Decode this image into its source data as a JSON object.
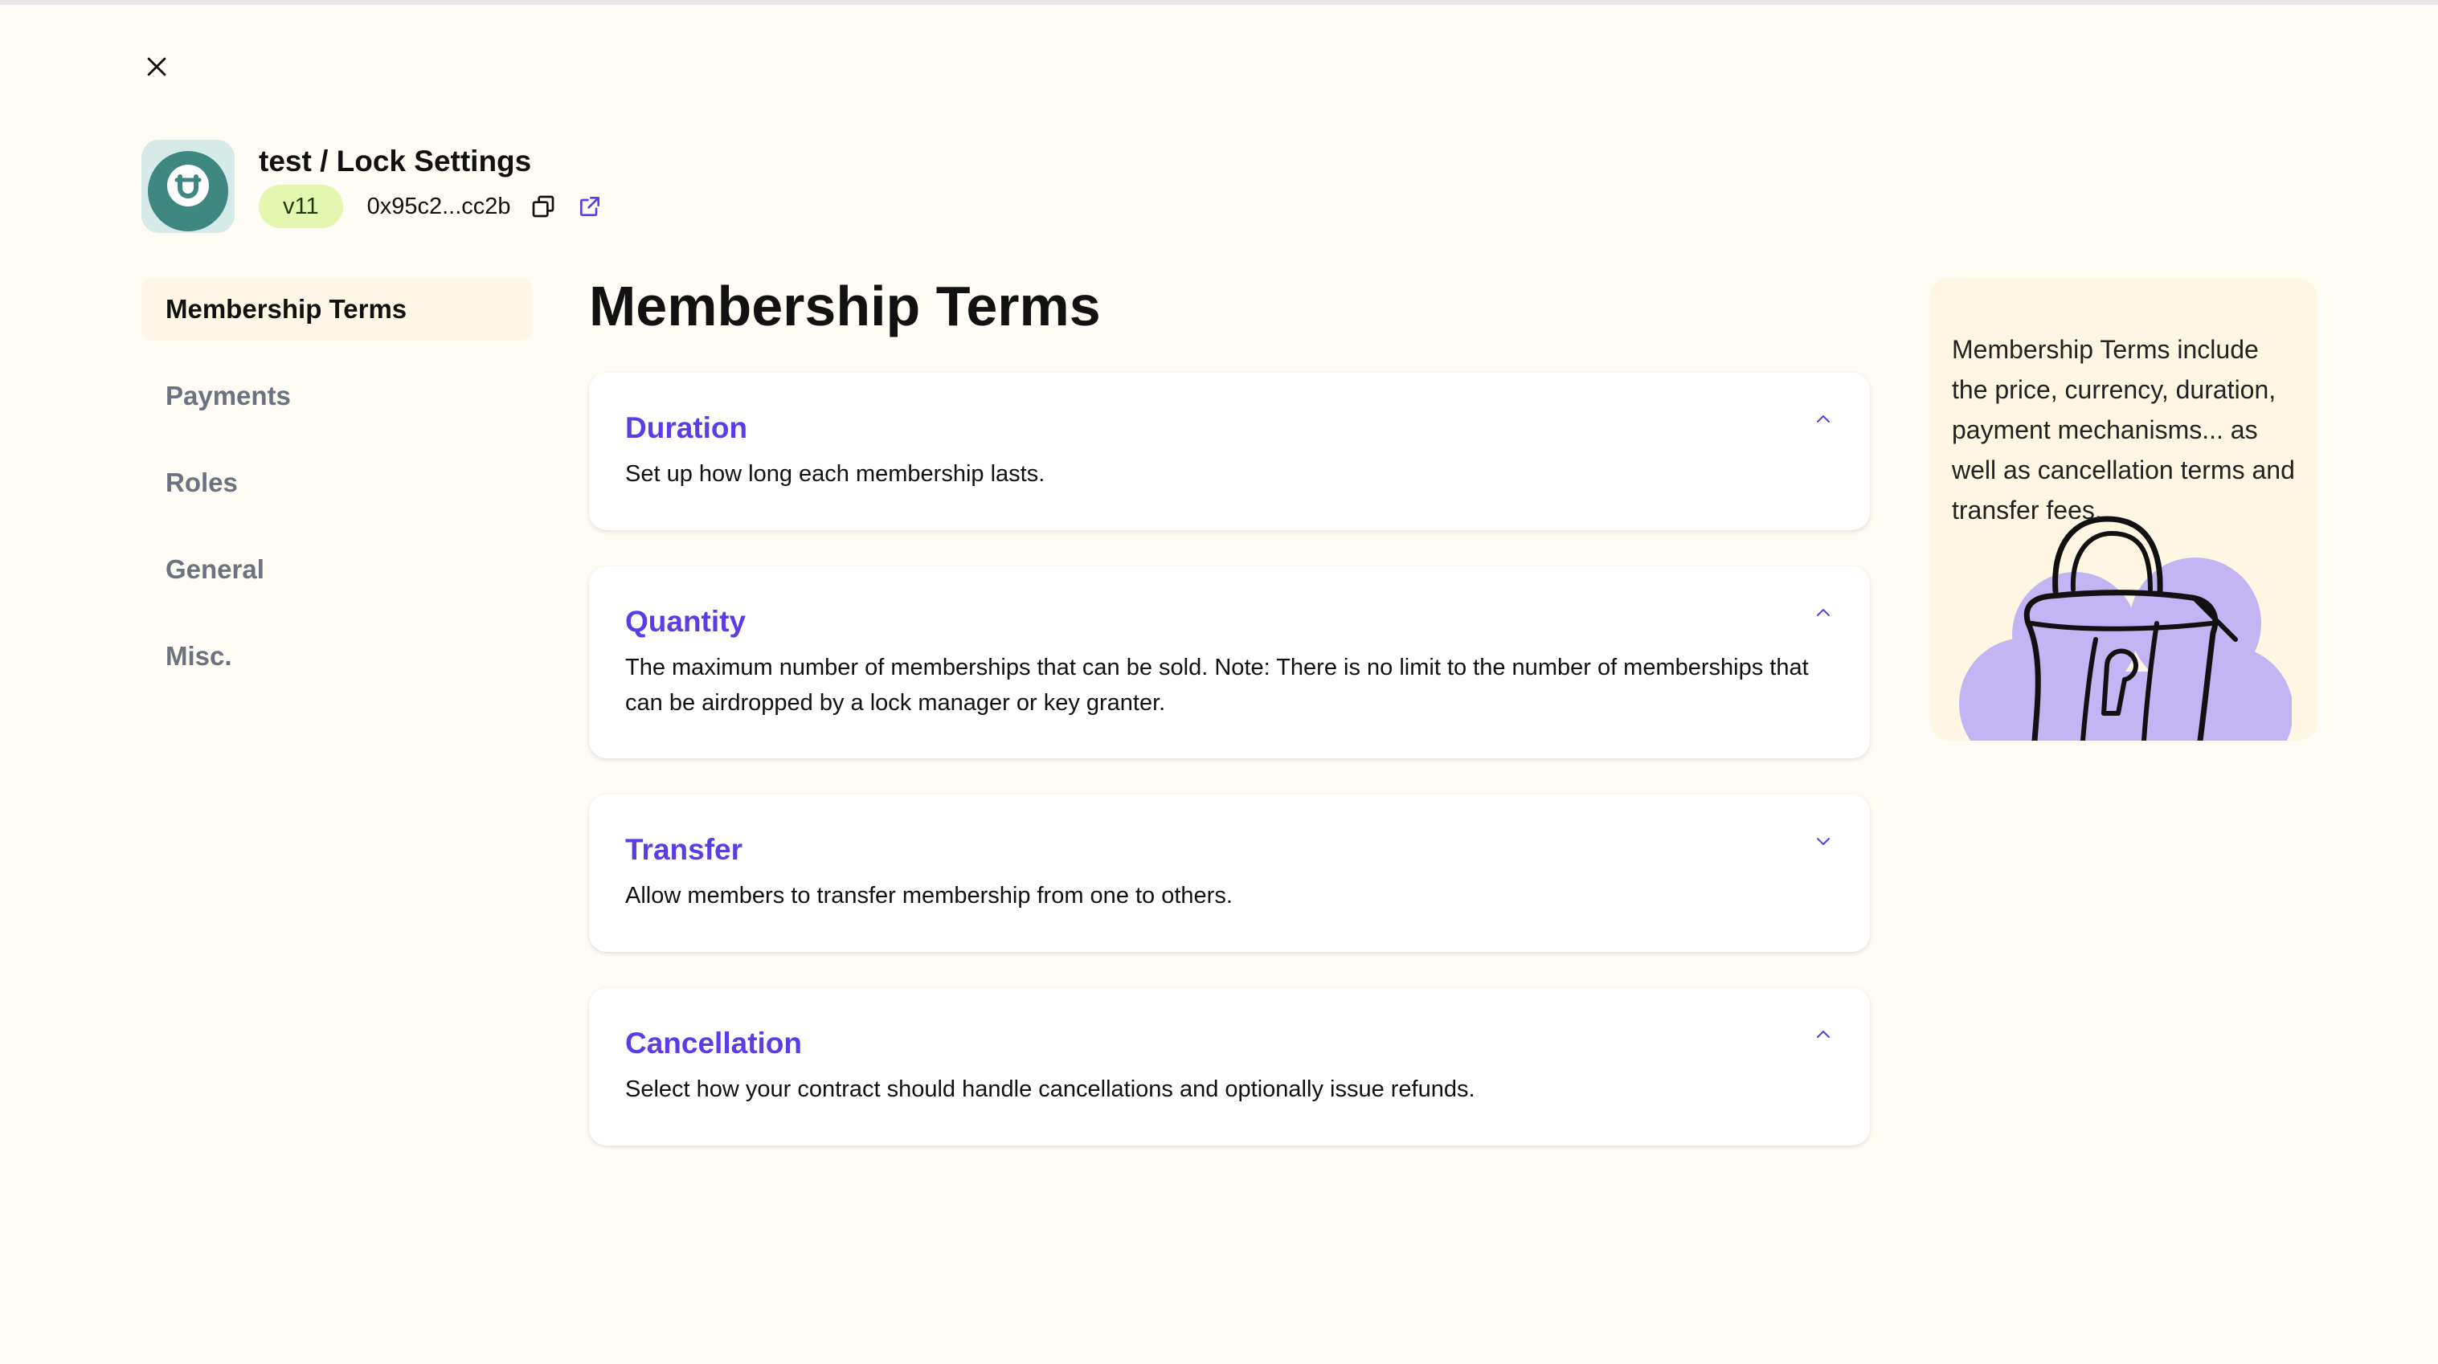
{
  "header": {
    "title": "test / Lock Settings",
    "version": "v11",
    "address": "0x95c2...cc2b"
  },
  "sidebar": {
    "items": [
      {
        "label": "Membership Terms",
        "active": true
      },
      {
        "label": "Payments",
        "active": false
      },
      {
        "label": "Roles",
        "active": false
      },
      {
        "label": "General",
        "active": false
      },
      {
        "label": "Misc.",
        "active": false
      }
    ]
  },
  "main": {
    "title": "Membership Terms",
    "sections": [
      {
        "title": "Duration",
        "description": "Set up how long each membership lasts.",
        "chevron": "chevron-up-icon"
      },
      {
        "title": "Quantity",
        "description": "The maximum number of memberships that can be sold. Note: There is no limit to the number of memberships that can be airdropped by a lock manager or key granter.",
        "chevron": "chevron-up-icon"
      },
      {
        "title": "Transfer",
        "description": "Allow members to transfer membership from one to others.",
        "chevron": "chevron-down-icon"
      },
      {
        "title": "Cancellation",
        "description": "Select how your contract should handle cancellations and optionally issue refunds.",
        "chevron": "chevron-up-icon"
      }
    ]
  },
  "info_panel": {
    "text": "Membership Terms include the price, currency, duration, payment mechanisms... as well as cancellation terms and transfer fees.",
    "illustration": "padlock-illustration"
  },
  "colors": {
    "background": "#fffbf5",
    "accent": "#5b3ce6",
    "badge": "#e3f7b0",
    "active_nav": "#fff7e5",
    "info_panel": "#fff6e4",
    "illustration": "#c3b5f4"
  }
}
